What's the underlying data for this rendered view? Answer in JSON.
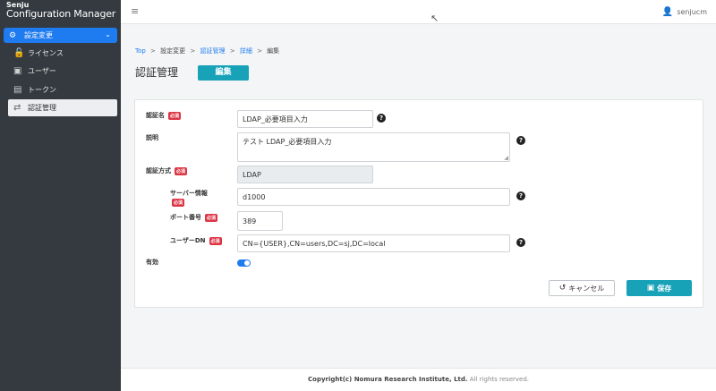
{
  "app": {
    "logo_line1": "Senju",
    "logo_line2": "Configuration Manager"
  },
  "sidebar": {
    "active_section": "設定変更",
    "items": [
      {
        "label": "ライセンス",
        "icon": "lock-icon"
      },
      {
        "label": "ユーザー",
        "icon": "user-card-icon"
      },
      {
        "label": "トークン",
        "icon": "token-icon"
      },
      {
        "label": "認証管理",
        "icon": "exchange-icon"
      }
    ]
  },
  "topbar": {
    "user_name": "senjucm"
  },
  "breadcrumb": {
    "top": "Top",
    "settings": "設定変更",
    "auth": "認証管理",
    "detail": "詳細",
    "current": "編集",
    "sep": ">"
  },
  "page": {
    "title": "認証管理",
    "mode": "編集"
  },
  "form": {
    "required_badge": "必須",
    "auth_name": {
      "label": "認証名",
      "value": "LDAP_必要項目入力"
    },
    "description": {
      "label": "説明",
      "value": "テスト LDAP_必要項目入力"
    },
    "auth_method": {
      "label": "認証方式",
      "value": "LDAP"
    },
    "server": {
      "label": "サーバー情報",
      "value": "d1000"
    },
    "port": {
      "label": "ポート番号",
      "value": "389"
    },
    "user_dn": {
      "label": "ユーザーDN",
      "value": "CN={USER},CN=users,DC=sj,DC=local"
    },
    "enabled": {
      "label": "有効",
      "value": true
    }
  },
  "buttons": {
    "cancel": "キャンセル",
    "save": "保存"
  },
  "footer": {
    "copyright": "Copyright(c) Nomura Research Institute, Ltd.",
    "rights": "All rights reserved."
  },
  "colors": {
    "accent": "#1f7bf0",
    "teal": "#17a2b8",
    "required": "#dc3545",
    "sidebar_bg": "#343a40"
  }
}
